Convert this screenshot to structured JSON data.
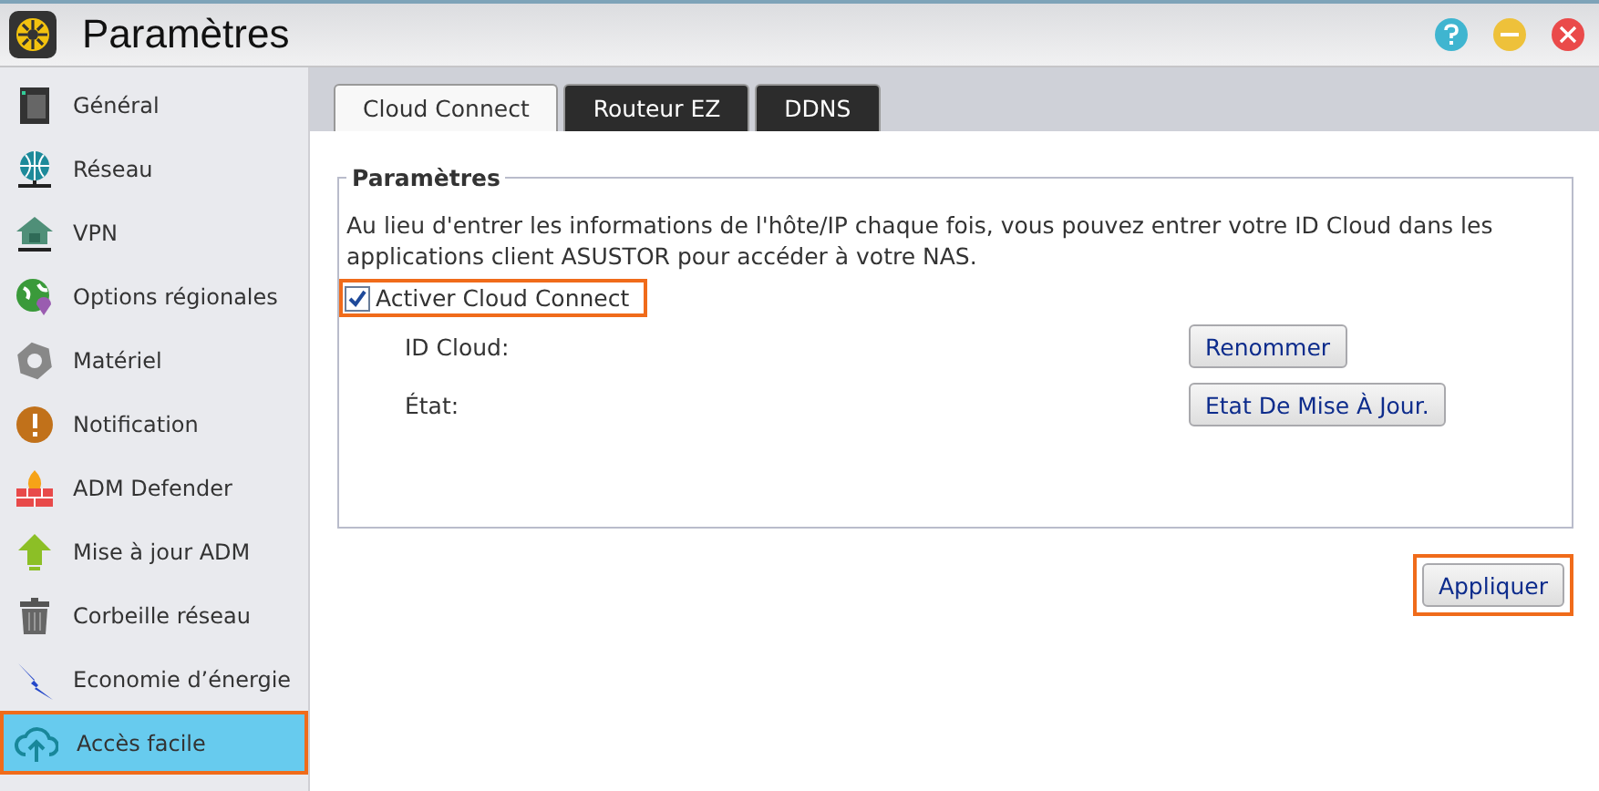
{
  "window": {
    "title": "Paramètres"
  },
  "sidebar": {
    "items": [
      {
        "label": "Général",
        "selected": false,
        "highlighted": false
      },
      {
        "label": "Réseau",
        "selected": false,
        "highlighted": false
      },
      {
        "label": "VPN",
        "selected": false,
        "highlighted": false
      },
      {
        "label": "Options régionales",
        "selected": false,
        "highlighted": false
      },
      {
        "label": "Matériel",
        "selected": false,
        "highlighted": false
      },
      {
        "label": "Notification",
        "selected": false,
        "highlighted": false
      },
      {
        "label": "ADM Defender",
        "selected": false,
        "highlighted": false
      },
      {
        "label": "Mise à jour ADM",
        "selected": false,
        "highlighted": false
      },
      {
        "label": "Corbeille réseau",
        "selected": false,
        "highlighted": false
      },
      {
        "label": "Economie d’énergie",
        "selected": false,
        "highlighted": false
      },
      {
        "label": "Accès facile",
        "selected": true,
        "highlighted": true
      }
    ]
  },
  "tabs": [
    {
      "label": "Cloud Connect",
      "selected": true
    },
    {
      "label": "Routeur EZ",
      "selected": false
    },
    {
      "label": "DDNS",
      "selected": false
    }
  ],
  "group": {
    "title": "Paramètres",
    "description": "Au lieu d'entrer les informations de l'hôte/IP chaque fois, vous pouvez entrer votre ID Cloud dans les applications client ASUSTOR pour accéder à votre NAS.",
    "checkbox": {
      "label": "Activer Cloud Connect",
      "checked": true,
      "highlighted": true
    },
    "rows": [
      {
        "label": "ID Cloud:",
        "button": "Renommer"
      },
      {
        "label": "État:",
        "button": "Etat De Mise À Jour."
      }
    ]
  },
  "apply": {
    "label": "Appliquer",
    "highlighted": true
  }
}
